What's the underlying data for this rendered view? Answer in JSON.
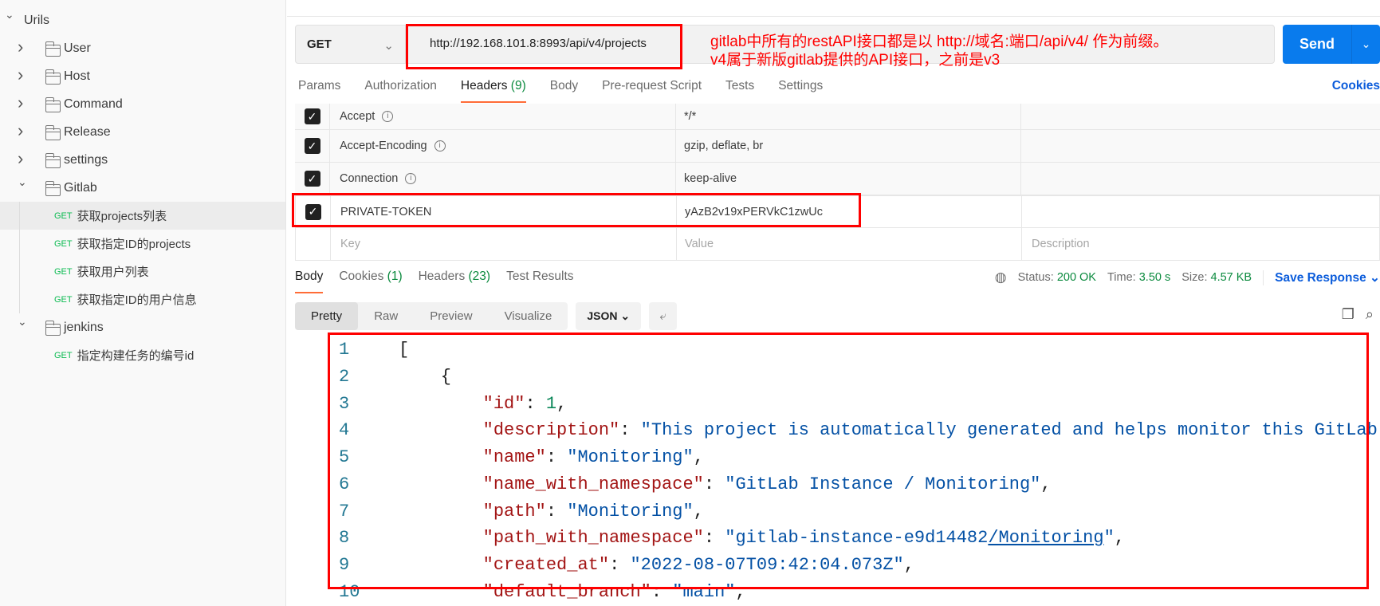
{
  "sidebar": {
    "root": "Urils",
    "folders": [
      "User",
      "Host",
      "Command",
      "Release",
      "settings",
      "Gitlab",
      "jenkins"
    ],
    "gitlab_requests": [
      {
        "method": "GET",
        "name": "获取projects列表"
      },
      {
        "method": "GET",
        "name": "获取指定ID的projects"
      },
      {
        "method": "GET",
        "name": "获取用户列表"
      },
      {
        "method": "GET",
        "name": "获取指定ID的用户信息"
      }
    ],
    "jenkins_requests": [
      {
        "method": "GET",
        "name": "指定构建任务的编号id"
      }
    ]
  },
  "request": {
    "method": "GET",
    "url": "http://192.168.101.8:8993/api/v4/projects",
    "send": "Send"
  },
  "annotation": {
    "line1": "gitlab中所有的restAPI接口都是以 http://域名:端口/api/v4/ 作为前缀。",
    "line2": "v4属于新版gitlab提供的API接口，之前是v3"
  },
  "tabs": [
    {
      "label": "Params"
    },
    {
      "label": "Authorization"
    },
    {
      "label": "Headers",
      "count": "(9)"
    },
    {
      "label": "Body"
    },
    {
      "label": "Pre-request Script"
    },
    {
      "label": "Tests"
    },
    {
      "label": "Settings"
    }
  ],
  "cookies_link": "Cookies",
  "headers": [
    {
      "key": "Accept",
      "value": "*/*"
    },
    {
      "key": "Accept-Encoding",
      "value": "gzip, deflate, br"
    },
    {
      "key": "Connection",
      "value": "keep-alive"
    },
    {
      "key": "PRIVATE-TOKEN",
      "value": "yAzB2v19xPERVkC1zwUc"
    }
  ],
  "header_placeholders": {
    "key": "Key",
    "value": "Value",
    "description": "Description"
  },
  "response_tabs": [
    {
      "label": "Body"
    },
    {
      "label": "Cookies",
      "count": "(1)"
    },
    {
      "label": "Headers",
      "count": "(23)"
    },
    {
      "label": "Test Results"
    }
  ],
  "status": {
    "status_label": "Status:",
    "status": "200 OK",
    "time_label": "Time:",
    "time": "3.50 s",
    "size_label": "Size:",
    "size": "4.57 KB",
    "save": "Save Response"
  },
  "view_modes": [
    "Pretty",
    "Raw",
    "Preview",
    "Visualize"
  ],
  "format": "JSON",
  "code_lines": [
    {
      "n": "1",
      "parts": [
        [
          "p",
          "["
        ]
      ]
    },
    {
      "n": "2",
      "parts": [
        [
          "p",
          "    {"
        ]
      ]
    },
    {
      "n": "3",
      "parts": [
        [
          "p",
          "        "
        ],
        [
          "k",
          "\"id\""
        ],
        [
          "p",
          ": "
        ],
        [
          "n",
          "1"
        ],
        [
          "p",
          ","
        ]
      ]
    },
    {
      "n": "4",
      "parts": [
        [
          "p",
          "        "
        ],
        [
          "k",
          "\"description\""
        ],
        [
          "p",
          ": "
        ],
        [
          "s",
          "\"This project is automatically generated and helps monitor this GitLab instance."
        ]
      ]
    },
    {
      "n": "5",
      "parts": [
        [
          "p",
          "        "
        ],
        [
          "k",
          "\"name\""
        ],
        [
          "p",
          ": "
        ],
        [
          "s",
          "\"Monitoring\""
        ],
        [
          "p",
          ","
        ]
      ]
    },
    {
      "n": "6",
      "parts": [
        [
          "p",
          "        "
        ],
        [
          "k",
          "\"name_with_namespace\""
        ],
        [
          "p",
          ": "
        ],
        [
          "s",
          "\"GitLab Instance / Monitoring\""
        ],
        [
          "p",
          ","
        ]
      ]
    },
    {
      "n": "7",
      "parts": [
        [
          "p",
          "        "
        ],
        [
          "k",
          "\"path\""
        ],
        [
          "p",
          ": "
        ],
        [
          "s",
          "\"Monitoring\""
        ],
        [
          "p",
          ","
        ]
      ]
    },
    {
      "n": "8",
      "parts": [
        [
          "p",
          "        "
        ],
        [
          "k",
          "\"path_with_namespace\""
        ],
        [
          "p",
          ": "
        ],
        [
          "s",
          "\"gitlab-instance-e9d14482"
        ],
        [
          "s u",
          "/Monitoring"
        ],
        [
          "s",
          "\""
        ],
        [
          "p",
          ","
        ]
      ]
    },
    {
      "n": "9",
      "parts": [
        [
          "p",
          "        "
        ],
        [
          "k",
          "\"created_at\""
        ],
        [
          "p",
          ": "
        ],
        [
          "s",
          "\"2022-08-07T09:42:04.073Z\""
        ],
        [
          "p",
          ","
        ]
      ]
    },
    {
      "n": "10",
      "parts": [
        [
          "p",
          "        "
        ],
        [
          "k",
          "\"default_branch\""
        ],
        [
          "p",
          ": "
        ],
        [
          "s",
          "\"main\""
        ],
        [
          "p",
          ","
        ]
      ]
    }
  ],
  "colors": {
    "accent": "#ff6c37",
    "send": "#097bed",
    "annotation": "#ff0000",
    "get": "#0cbb52"
  }
}
